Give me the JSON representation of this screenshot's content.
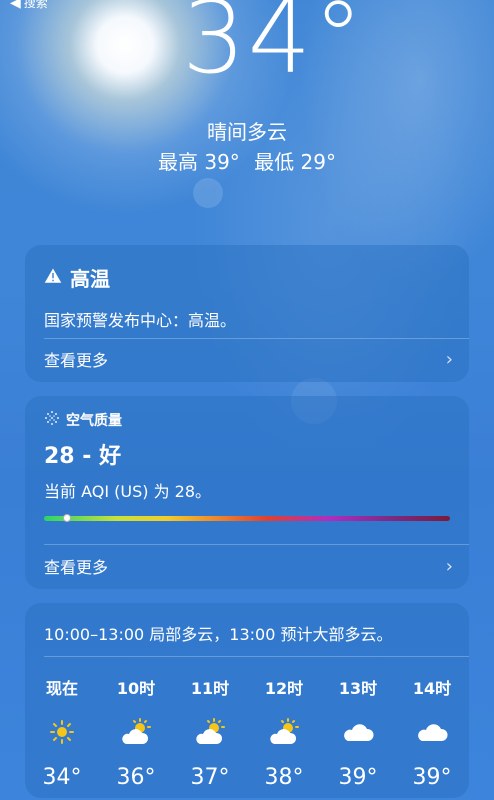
{
  "nav": {
    "back_label": "搜索"
  },
  "current": {
    "temperature": "34°",
    "condition": "晴间多云",
    "high": "最高 39°",
    "low": "最低 29°"
  },
  "alert": {
    "title": "高温",
    "body": "国家预警发布中心：高温。",
    "more_label": "查看更多",
    "icon": "warning-icon"
  },
  "air_quality": {
    "header": "空气质量",
    "value": "28 - 好",
    "description": "当前 AQI (US) 为 28。",
    "aqi": 28,
    "more_label": "查看更多",
    "icon": "air-quality-icon"
  },
  "hourly": {
    "summary": "10:00–13:00 局部多云，13:00 预计大部多云。",
    "items": [
      {
        "time": "现在",
        "icon": "sun-icon",
        "temp": "34°"
      },
      {
        "time": "10时",
        "icon": "partly-cloudy-icon",
        "temp": "36°"
      },
      {
        "time": "11时",
        "icon": "partly-cloudy-icon",
        "temp": "37°"
      },
      {
        "time": "12时",
        "icon": "partly-cloudy-icon",
        "temp": "38°"
      },
      {
        "time": "13时",
        "icon": "cloud-icon",
        "temp": "39°"
      },
      {
        "time": "14时",
        "icon": "cloud-icon",
        "temp": "39°"
      }
    ]
  },
  "colors": {
    "sky": "#3f86d6",
    "card": "#286ebe",
    "sun_yellow": "#f5c518"
  }
}
